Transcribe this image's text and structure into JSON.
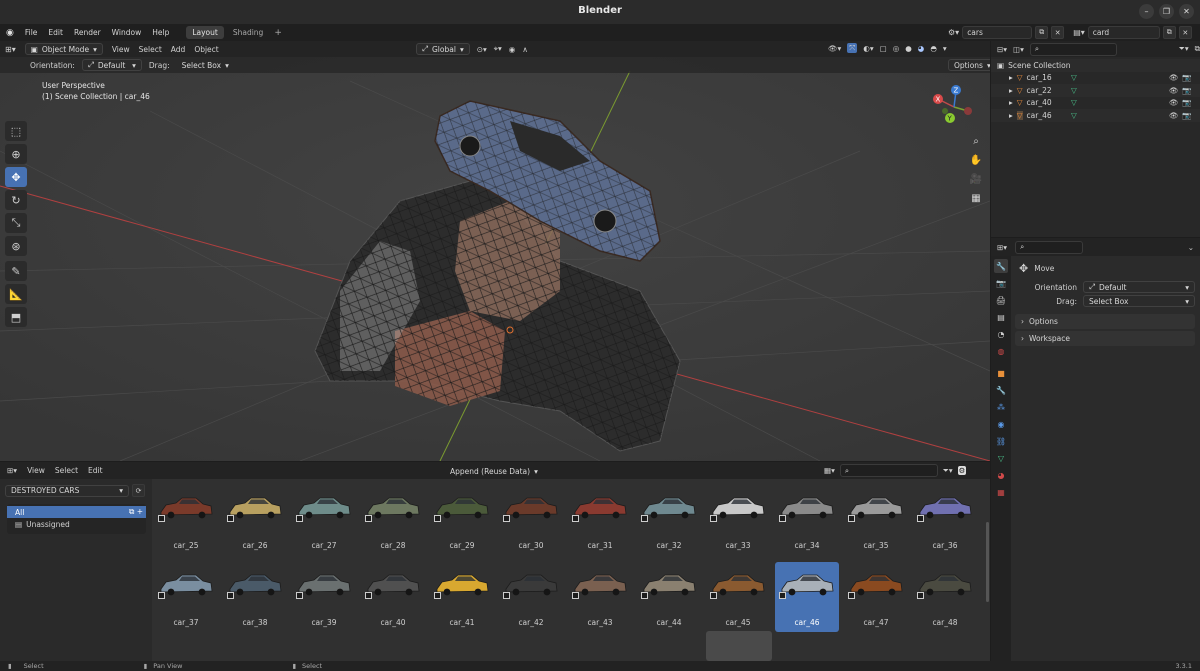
{
  "window": {
    "title": "Blender"
  },
  "menu": [
    "File",
    "Edit",
    "Render",
    "Window",
    "Help"
  ],
  "workspace_tabs": [
    {
      "label": "Layout",
      "active": true
    },
    {
      "label": "Shading",
      "active": false
    }
  ],
  "topbar": {
    "add_tab": "+",
    "scene_name": "cars",
    "view_layer": "card"
  },
  "viewport": {
    "mode": "Object Mode",
    "menus": [
      "View",
      "Select",
      "Add",
      "Object"
    ],
    "transform_orientation": "Global",
    "orientation_label": "Orientation:",
    "orientation_value": "Default",
    "drag_label": "Drag:",
    "drag_value": "Select Box",
    "options": "Options",
    "info_line1": "User Perspective",
    "info_line2": "(1) Scene Collection | car_46",
    "gizmo": {
      "x": "X",
      "y": "Y",
      "z": "Z"
    }
  },
  "outliner": {
    "root": "Scene Collection",
    "items": [
      "car_16",
      "car_22",
      "car_40",
      "car_46"
    ]
  },
  "properties": {
    "tool_name": "Move",
    "orientation_label": "Orientation",
    "orientation_value": "Default",
    "drag_label": "Drag:",
    "drag_value": "Select Box",
    "panels": [
      "Options",
      "Workspace"
    ]
  },
  "asset_browser": {
    "menus": [
      "View",
      "Select",
      "Edit"
    ],
    "import_method": "Append (Reuse Data)",
    "library": "DESTROYED CARS",
    "catalogs": [
      {
        "label": "All",
        "selected": true
      },
      {
        "label": "Unassigned",
        "selected": false
      }
    ],
    "row1": [
      "car_25",
      "car_26",
      "car_27",
      "car_28",
      "car_29",
      "car_30",
      "car_31",
      "car_32",
      "car_33",
      "car_34",
      "car_35",
      "car_36"
    ],
    "row2": [
      "car_37",
      "car_38",
      "car_39",
      "car_40",
      "car_41",
      "car_42",
      "car_43",
      "car_44",
      "car_45",
      "car_46",
      "car_47",
      "car_48"
    ],
    "selected": "car_46",
    "car_colors_row1": [
      "#7a3a2a",
      "#b8a060",
      "#6e8c8a",
      "#6d7860",
      "#4b5a3a",
      "#6a3a2a",
      "#8a3a30",
      "#6f8990",
      "#c8c8c8",
      "#8a8a8a",
      "#9a9a9a",
      "#7070b0"
    ],
    "car_colors_row2": [
      "#7a8ea0",
      "#4a5a68",
      "#6a7070",
      "#505050",
      "#d8a830",
      "#3a3a3a",
      "#7a6050",
      "#8a8070",
      "#8a5a30",
      "#a8b0b8",
      "#8a4a20",
      "#4a4a40"
    ]
  },
  "statusbar": {
    "left": "Select",
    "middle": "Pan View",
    "right": "Select",
    "version": "3.3.1"
  }
}
